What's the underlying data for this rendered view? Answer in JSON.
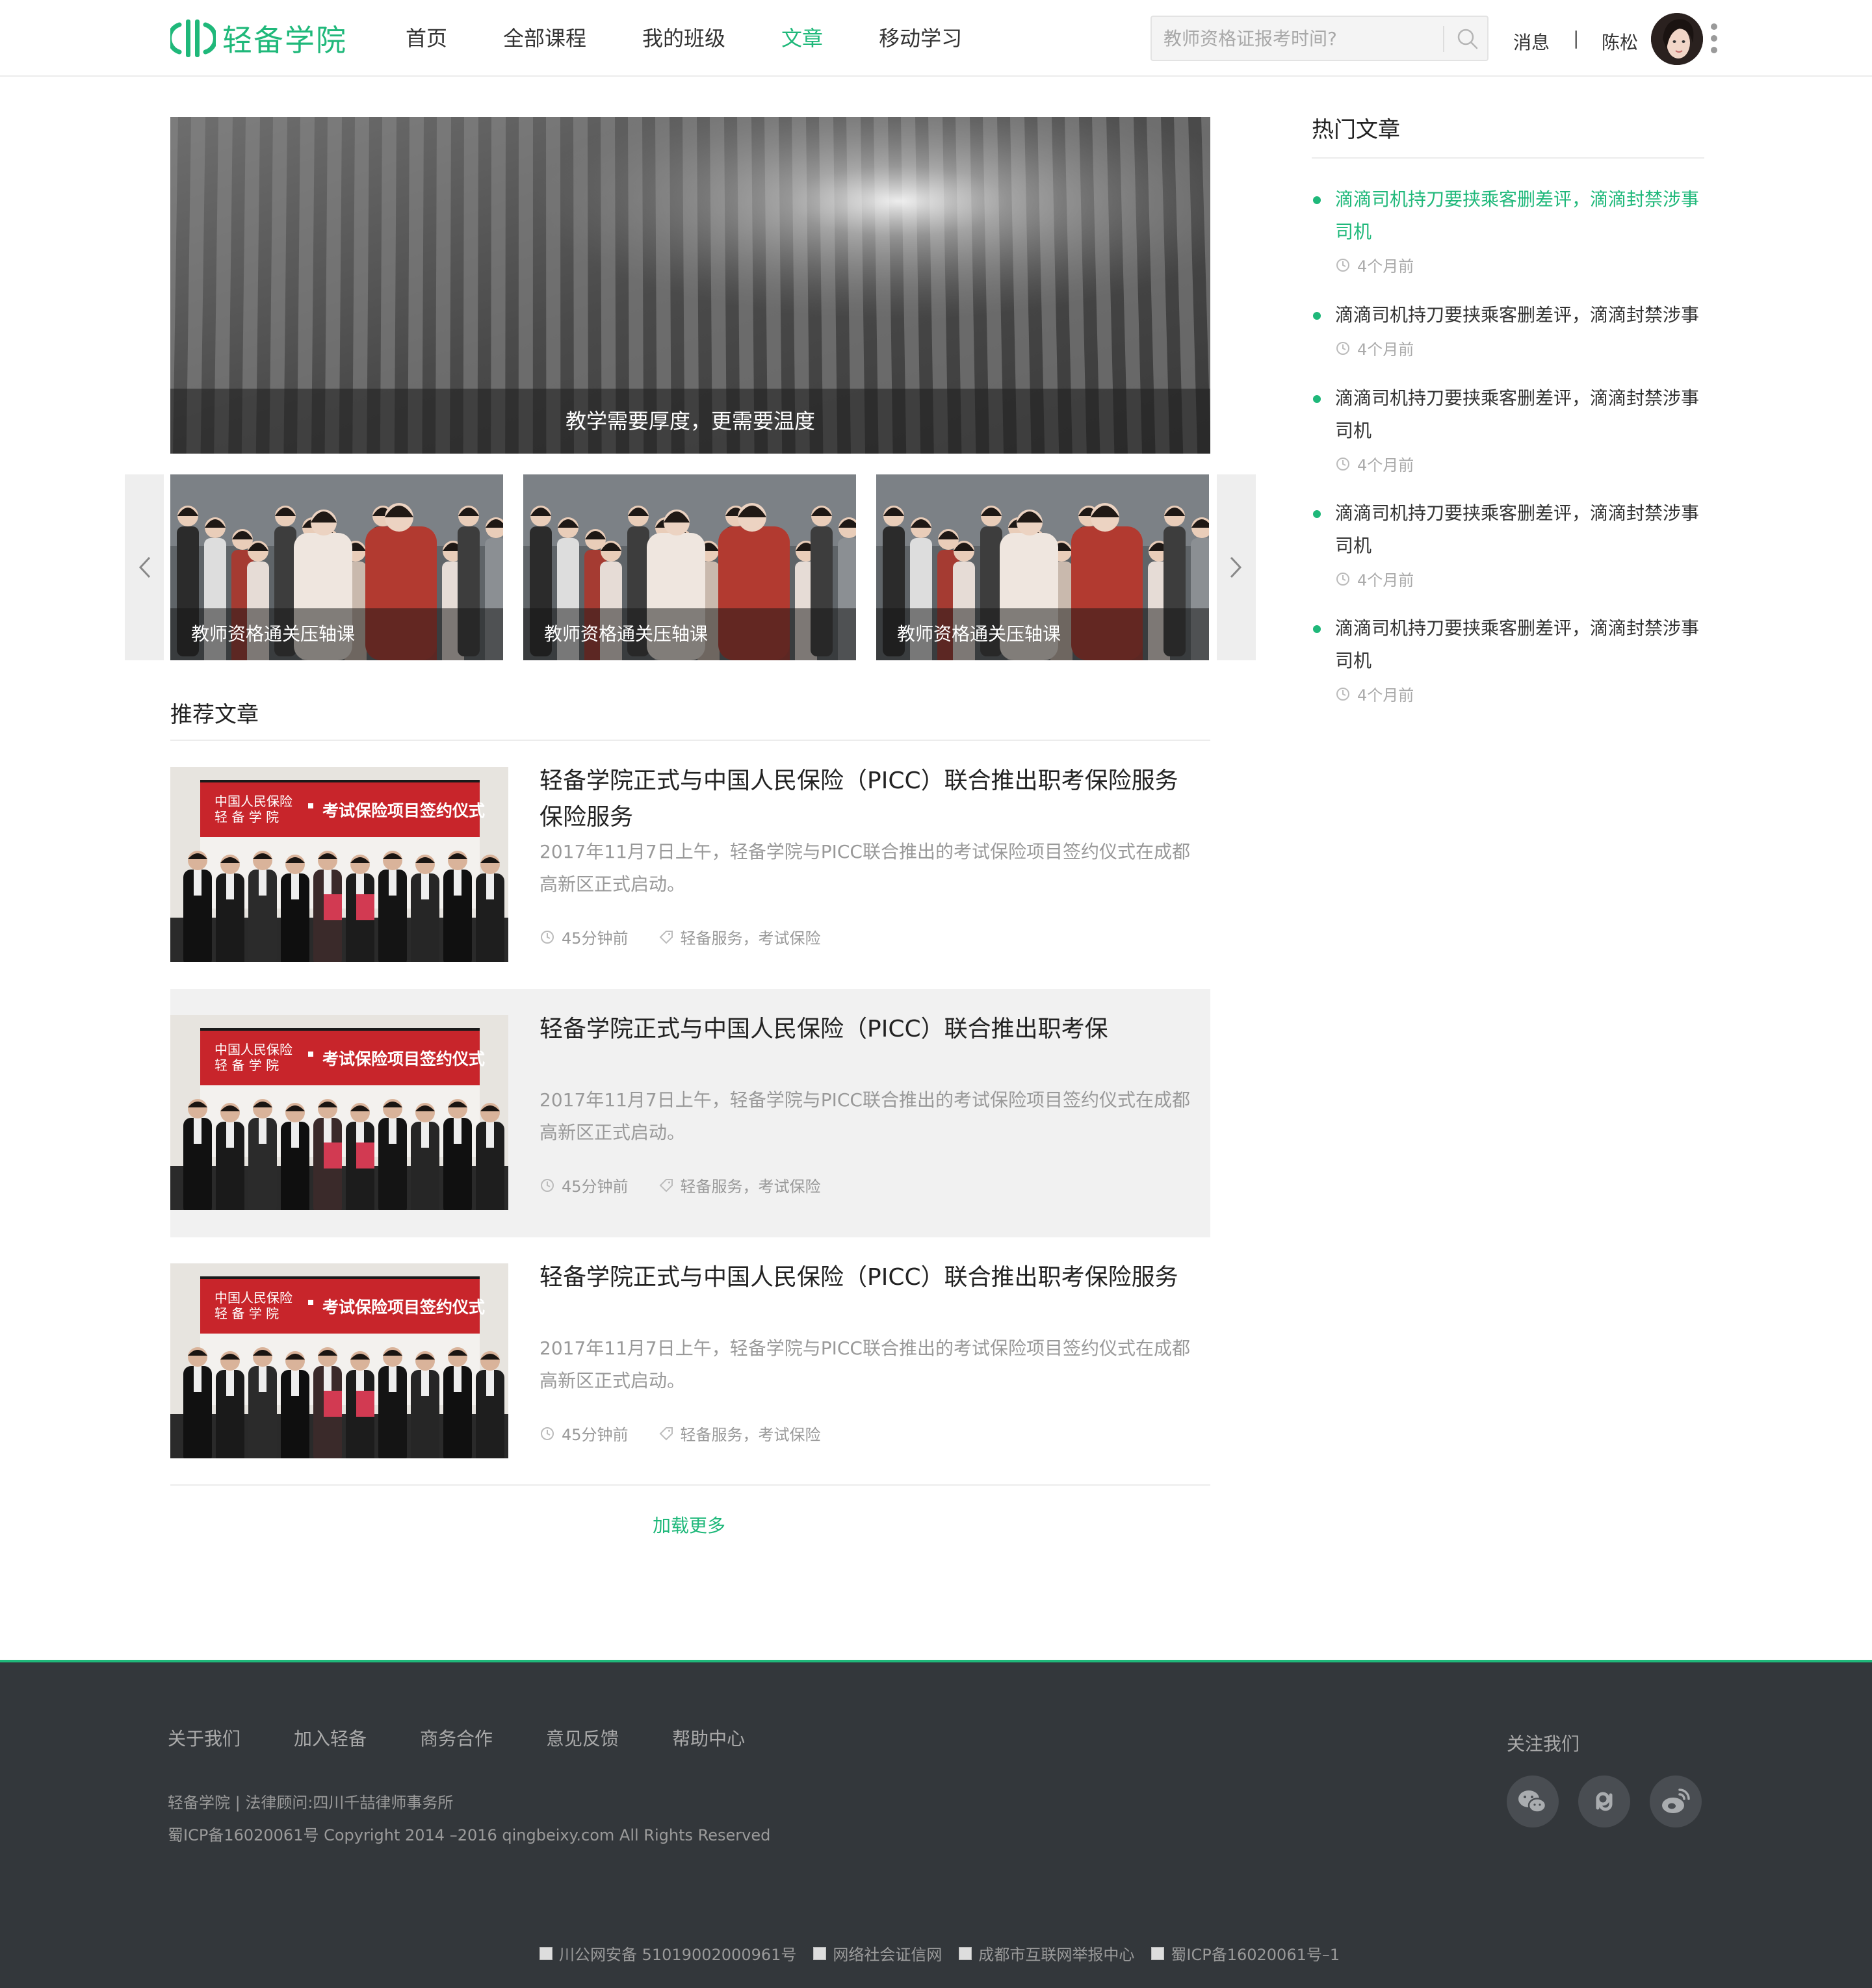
{
  "header": {
    "logo_text": "轻备学院",
    "nav": [
      "首页",
      "全部课程",
      "我的班级",
      "文章",
      "移动学习"
    ],
    "active_nav": "文章",
    "search_placeholder": "教师资格证报考时间?",
    "messages_label": "消息",
    "separator": "|",
    "user_name": "陈松"
  },
  "hero": {
    "caption": "教学需要厚度，更需要温度"
  },
  "carousel": {
    "items": [
      {
        "caption": "教师资格通关压轴课"
      },
      {
        "caption": "教师资格通关压轴课"
      },
      {
        "caption": "教师资格通关压轴课"
      }
    ]
  },
  "recommended": {
    "title": "推荐文章",
    "articles": [
      {
        "title": "轻备学院正式与中国人民保险（PICC）联合推出职考保险服务保险服务",
        "desc": "2017年11月7日上午，轻备学院与PICC联合推出的考试保险项目签约仪式在成都高新区正式启动。",
        "time": "45分钟前",
        "tags": "轻备服务，考试保险",
        "banner_line1": "中国人民保险",
        "banner_line2": "轻 备 学 院",
        "banner_title": "考试保险项目签约仪式"
      },
      {
        "title": "轻备学院正式与中国人民保险（PICC）联合推出职考保",
        "desc": "2017年11月7日上午，轻备学院与PICC联合推出的考试保险项目签约仪式在成都高新区正式启动。",
        "time": "45分钟前",
        "tags": "轻备服务，考试保险",
        "banner_line1": "中国人民保险",
        "banner_line2": "轻 备 学 院",
        "banner_title": "考试保险项目签约仪式"
      },
      {
        "title": "轻备学院正式与中国人民保险（PICC）联合推出职考保险服务",
        "desc": "2017年11月7日上午，轻备学院与PICC联合推出的考试保险项目签约仪式在成都高新区正式启动。",
        "time": "45分钟前",
        "tags": "轻备服务，考试保险",
        "banner_line1": "中国人民保险",
        "banner_line2": "轻 备 学 院",
        "banner_title": "考试保险项目签约仪式"
      }
    ],
    "load_more": "加载更多"
  },
  "hot": {
    "title": "热门文章",
    "items": [
      {
        "text": "滴滴司机持刀要挟乘客删差评，滴滴封禁涉事司机",
        "time": "4个月前"
      },
      {
        "text": "滴滴司机持刀要挟乘客删差评，滴滴封禁涉事",
        "time": "4个月前"
      },
      {
        "text": "滴滴司机持刀要挟乘客删差评，滴滴封禁涉事司机",
        "time": "4个月前"
      },
      {
        "text": "滴滴司机持刀要挟乘客删差评，滴滴封禁涉事司机",
        "time": "4个月前"
      },
      {
        "text": "滴滴司机持刀要挟乘客删差评，滴滴封禁涉事司机",
        "time": "4个月前"
      }
    ]
  },
  "footer": {
    "links": [
      "关于我们",
      "加入轻备",
      "商务合作",
      "意见反馈",
      "帮助中心"
    ],
    "legal": "轻备学院 | 法律顾问:四川千喆律师事务所",
    "copyright": "蜀ICP备16020061号 Copyright 2014 –2016 qingbeixy.com All Rights Reserved",
    "follow_label": "关注我们",
    "social_icons": [
      "wechat-icon",
      "link-icon",
      "weibo-icon"
    ],
    "badges": [
      "川公网安备 51019002000961号",
      "网络社会证信网",
      "成都市互联网举报中心",
      "蜀ICP备16020061号–1"
    ]
  },
  "colors": {
    "brand": "#1fb87a",
    "footer_bg": "#33373b",
    "highlight_row": "#f1f1f1"
  }
}
